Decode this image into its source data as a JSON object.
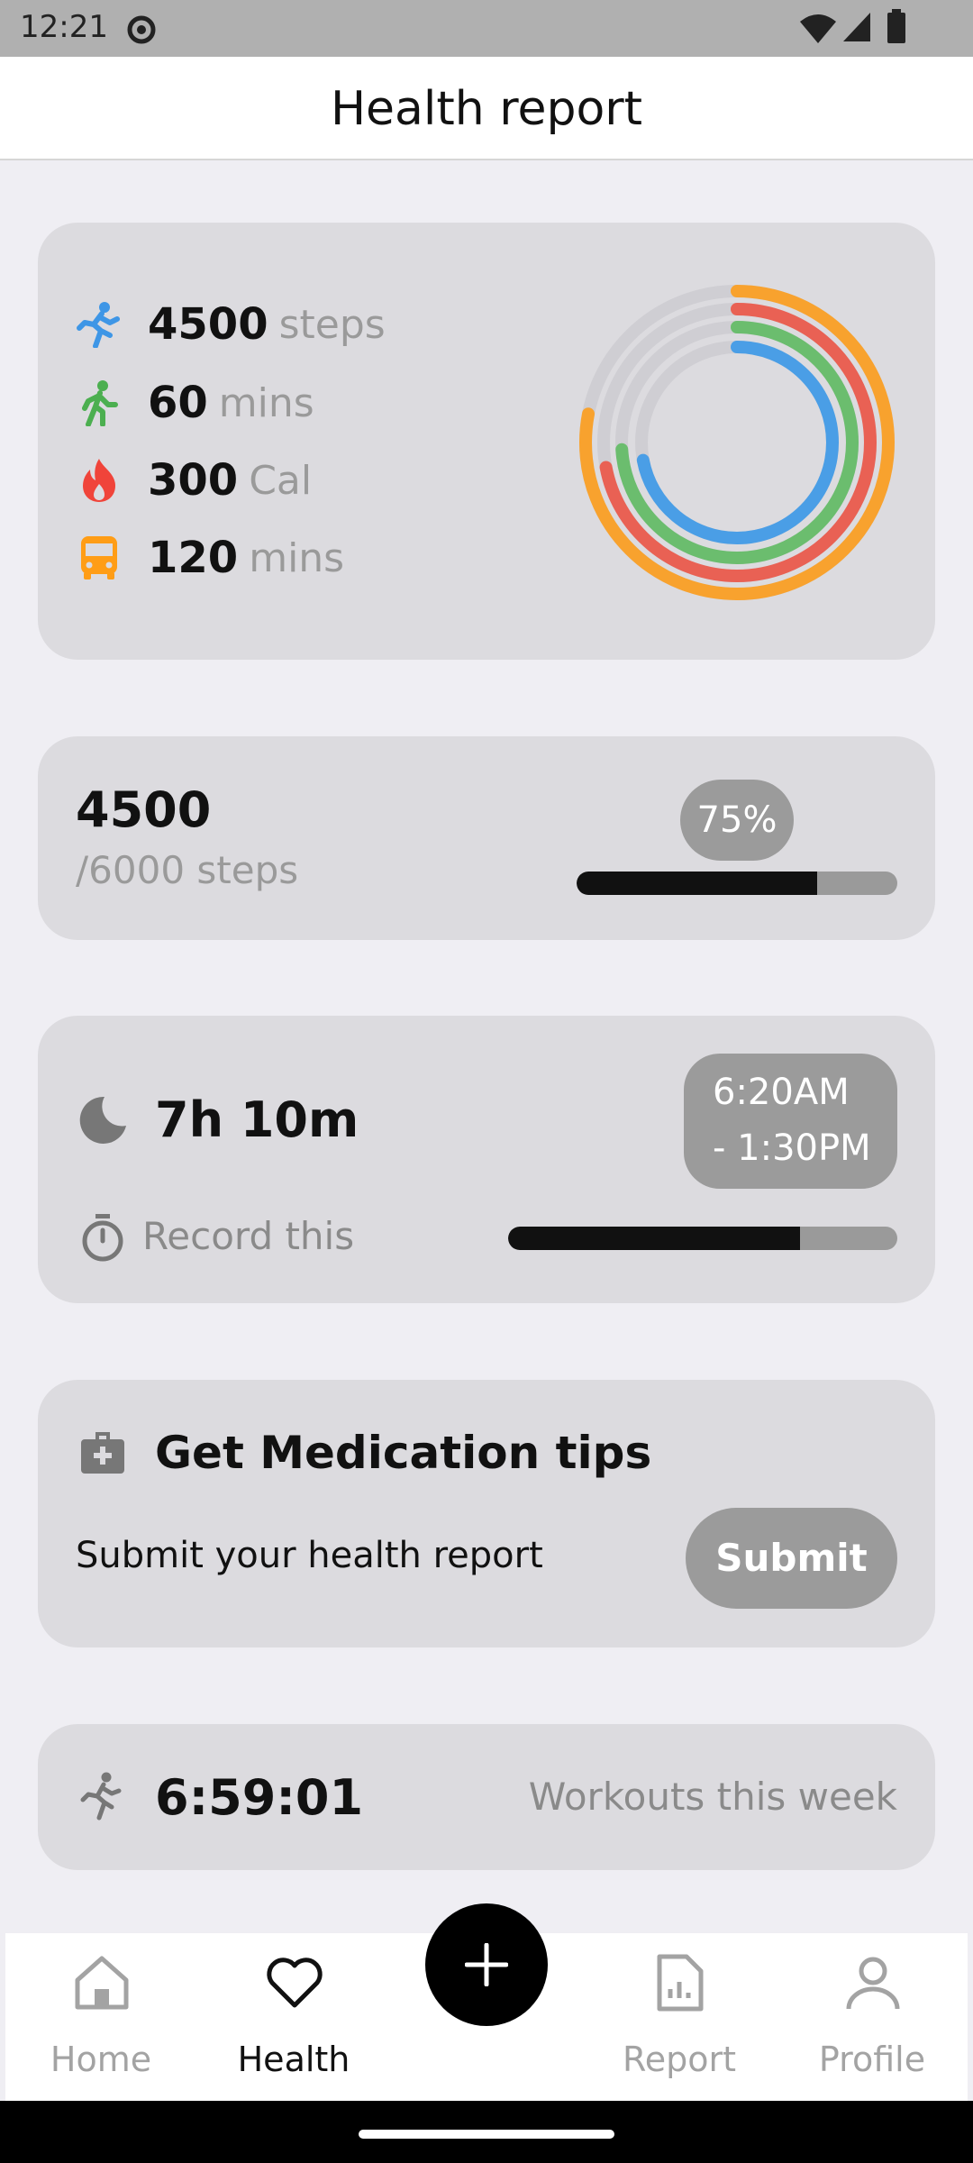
{
  "status_bar": {
    "time": "12:21"
  },
  "app_bar": {
    "title": "Health report"
  },
  "activity": {
    "rows": [
      {
        "value": "4500",
        "unit": "steps",
        "icon": "run-icon",
        "color": "#3e96e6"
      },
      {
        "value": "60",
        "unit": "mins",
        "icon": "walk-icon",
        "color": "#4caf50"
      },
      {
        "value": "300",
        "unit": "Cal",
        "icon": "flame-icon",
        "color": "#f0443a"
      },
      {
        "value": "120",
        "unit": "mins",
        "icon": "bus-icon",
        "color": "#ff9d16"
      }
    ],
    "ring_colors": [
      "#f8a22e",
      "#e96154",
      "#6bbd6e",
      "#4a9ee6"
    ],
    "ring_fractions": [
      0.78,
      0.72,
      0.74,
      0.72
    ]
  },
  "steps": {
    "count": "4500",
    "goal": "/6000 steps",
    "percent": "75%",
    "progress": 0.75
  },
  "sleep": {
    "duration": "7h 10m",
    "time_line1": "6:20AM",
    "time_line2": "- 1:30PM",
    "record_label": "Record this",
    "progress": 0.75
  },
  "medication": {
    "title": "Get Medication tips",
    "subtitle": "Submit your health report",
    "button": "Submit"
  },
  "workouts": {
    "time": "6:59:01",
    "label": "Workouts this week"
  },
  "nav": {
    "home": "Home",
    "health": "Health",
    "report": "Report",
    "profile": "Profile"
  }
}
